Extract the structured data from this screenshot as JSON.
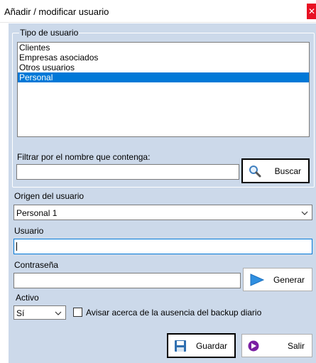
{
  "window": {
    "title": "Añadir / modificar usuario",
    "close_glyph": "✕"
  },
  "user_type": {
    "legend": "Tipo de usuario",
    "items": [
      "Clientes",
      "Empresas asociados",
      "Otros usuarios",
      "Personal"
    ],
    "selected_index": 3
  },
  "filter": {
    "label": "Filtrar por el  nombre que contenga:",
    "value": "",
    "search_label": "Buscar"
  },
  "origin": {
    "label": "Origen del usuario",
    "selected": "Personal 1"
  },
  "username": {
    "label": "Usuario",
    "value": ""
  },
  "password": {
    "label": "Contraseña",
    "value": "",
    "generate_label": "Generar"
  },
  "active": {
    "label": "Activo",
    "selected": "Sí"
  },
  "backup_warning": {
    "label": "Avisar acerca de la ausencia del backup diario",
    "checked": false
  },
  "actions": {
    "save_label": "Guardar",
    "exit_label": "Salir"
  },
  "icons": {
    "search": "magnifier-icon",
    "generate": "play-arrow-icon",
    "save": "floppy-disk-icon",
    "exit": "exit-arrow-icon"
  },
  "colors": {
    "selection": "#0078d7",
    "panel": "#ccd9ea",
    "close": "#e81123"
  }
}
